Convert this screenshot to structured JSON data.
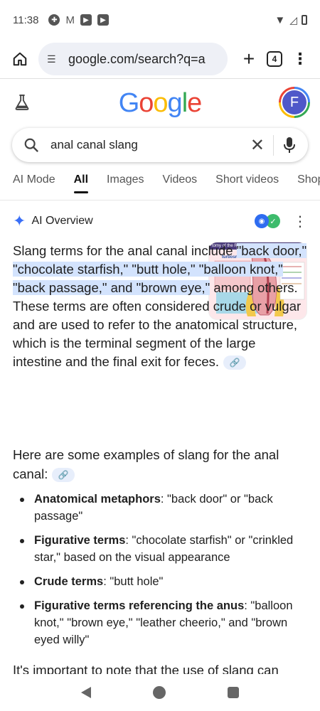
{
  "status_bar": {
    "time": "11:38"
  },
  "browser": {
    "url": "google.com/search?q=a",
    "tab_count": "4"
  },
  "google": {
    "logo": [
      "G",
      "o",
      "o",
      "g",
      "l",
      "e"
    ],
    "logo_colors": [
      "#4285F4",
      "#EA4335",
      "#FBBC05",
      "#4285F4",
      "#34A853",
      "#EA4335"
    ],
    "avatar_letter": "F"
  },
  "search": {
    "query": "anal canal slang"
  },
  "tabs": [
    "AI Mode",
    "All",
    "Images",
    "Videos",
    "Short videos",
    "Shop"
  ],
  "ai_overview": {
    "title": "AI Overview",
    "intro_before": "Slang terms for the anal canal include ",
    "intro_highlight": "\"back door,\" \"choco­late starfish,\" \"butt hole,\" \"balloon knot,\" \"back pas­sage,\" and \"brown eye,\"",
    "intro_after": " among others. These terms are often consid­ered crude or vulgar and are used to refer to the anatomical structure, which is the terminal segment of the large intestine and the final exit for feces.",
    "thumb_caption": "tomy of the Rectum and Anal Canal",
    "thumb_site": "turbosmds.com",
    "subheading": "Here are some examples of slang for the anal canal:",
    "examples": [
      {
        "term": "Anatomical metaphors",
        "desc": ": \"back door\" or \"back passage\""
      },
      {
        "term": "Figurative terms",
        "desc": ": \"chocolate starfish\" or \"crinkled star,\" based on the visual appearance"
      },
      {
        "term": "Crude terms",
        "desc": ": \"butt hole\""
      },
      {
        "term": "Figurative terms referencing the anus",
        "desc": ": \"balloon knot,\" \"brown eye,\" \"leather cheerio,\" and \"brown eyed willy\""
      }
    ],
    "cut_text": "It's important to note that the use of slang can"
  }
}
